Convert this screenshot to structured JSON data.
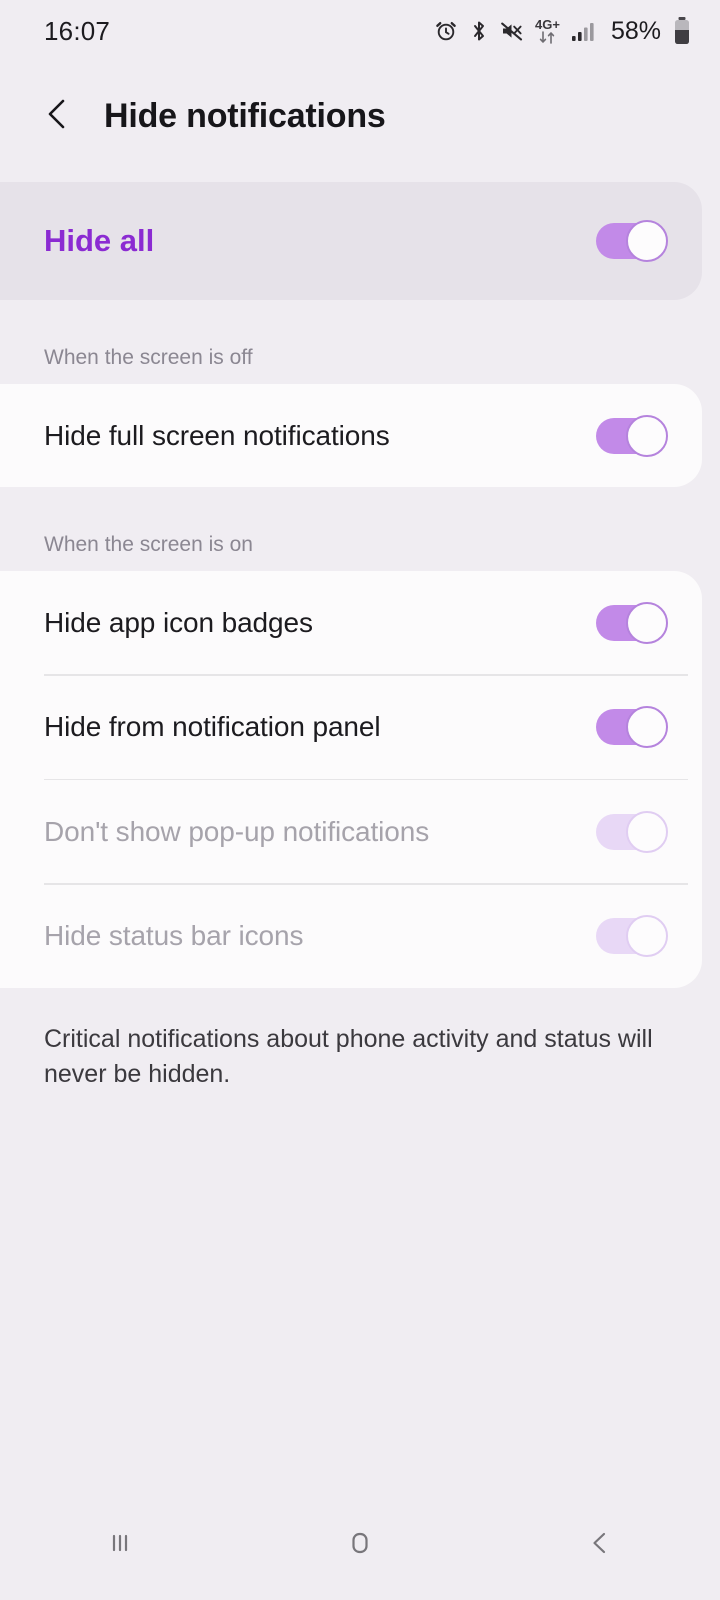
{
  "status_bar": {
    "time": "16:07",
    "network_label": "4G+",
    "battery_percent": "58%",
    "icons": [
      "alarm-icon",
      "bluetooth-icon",
      "mute-icon",
      "mobile-data-icon",
      "signal-icon",
      "battery-icon"
    ]
  },
  "header": {
    "back_icon": "chevron-left-icon",
    "title": "Hide notifications"
  },
  "master": {
    "label": "Hide all",
    "toggle_state": "on"
  },
  "sections": [
    {
      "label": "When the screen is off",
      "rows": [
        {
          "label": "Hide full screen notifications",
          "toggle_state": "on",
          "enabled": true
        }
      ]
    },
    {
      "label": "When the screen is on",
      "rows": [
        {
          "label": "Hide app icon badges",
          "toggle_state": "on",
          "enabled": true
        },
        {
          "label": "Hide from notification panel",
          "toggle_state": "on",
          "enabled": true
        },
        {
          "label": "Don't show pop-up notifications",
          "toggle_state": "on",
          "enabled": false
        },
        {
          "label": "Hide status bar icons",
          "toggle_state": "on",
          "enabled": false
        }
      ]
    }
  ],
  "footnote": "Critical notifications about phone activity and status will never be hidden.",
  "nav_bar": {
    "recents_icon": "recents-icon",
    "home_icon": "home-icon",
    "back_icon": "back-icon"
  },
  "colors": {
    "page_background": "#f0edf2",
    "card_background": "#fcfbfc",
    "master_card_background": "#e6e2e9",
    "accent_purple": "#8b2bd2",
    "toggle_on_track": "#c28ae8",
    "toggle_disabled_track": "#e8d8f6"
  }
}
